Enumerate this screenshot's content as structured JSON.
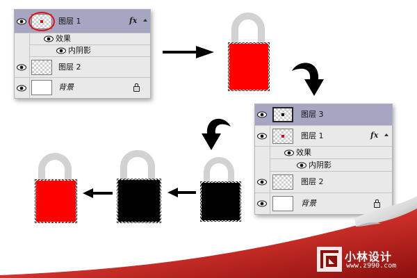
{
  "panel_top": {
    "rows": [
      {
        "name": "图层 1",
        "fx": "fx"
      },
      {
        "name": "效果"
      },
      {
        "name": "内阴影"
      },
      {
        "name": "图层 2"
      },
      {
        "name": "背景"
      }
    ]
  },
  "panel_bottom": {
    "rows": [
      {
        "name": "图层 3"
      },
      {
        "name": "图层 1",
        "fx": "fx"
      },
      {
        "name": "效果"
      },
      {
        "name": "内阴影"
      },
      {
        "name": "图层 2"
      },
      {
        "name": "背景"
      }
    ]
  },
  "watermark": {
    "title": "小林设计",
    "url": "www.z990.com"
  },
  "colors": {
    "lock_red": "#ff0000",
    "lock_black": "#000000",
    "shackle_gray": "#d2d2d2",
    "selected_row": "#a6a6c3",
    "curl_red": "#c3221f"
  }
}
